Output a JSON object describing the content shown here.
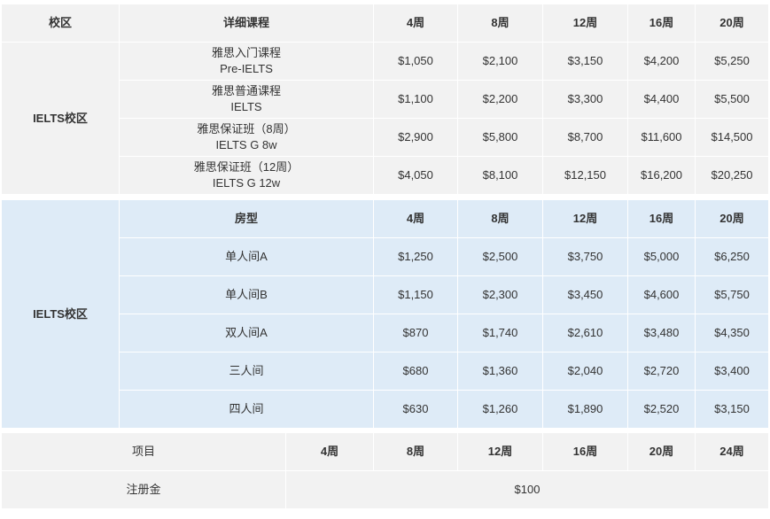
{
  "tuition": {
    "headers": [
      "校区",
      "详细课程",
      "4周",
      "8周",
      "12周",
      "16周",
      "20周"
    ],
    "campus": "IELTS校区",
    "rows": [
      {
        "course_cn": "雅思入门课程",
        "course_en": "Pre-IELTS",
        "prices": [
          "$1,050",
          "$2,100",
          "$3,150",
          "$4,200",
          "$5,250"
        ]
      },
      {
        "course_cn": "雅思普通课程",
        "course_en": "IELTS",
        "prices": [
          "$1,100",
          "$2,200",
          "$3,300",
          "$4,400",
          "$5,500"
        ]
      },
      {
        "course_cn": "雅思保证班（8周）",
        "course_en": "IELTS G 8w",
        "prices": [
          "$2,900",
          "$5,800",
          "$8,700",
          "$11,600",
          "$14,500"
        ]
      },
      {
        "course_cn": "雅思保证班（12周）",
        "course_en": "IELTS G 12w",
        "prices": [
          "$4,050",
          "$8,100",
          "$12,150",
          "$16,200",
          "$20,250"
        ]
      }
    ]
  },
  "dorm": {
    "campus": "IELTS校区",
    "headers": [
      "房型",
      "4周",
      "8周",
      "12周",
      "16周",
      "20周"
    ],
    "rows": [
      {
        "room": "单人间A",
        "prices": [
          "$1,250",
          "$2,500",
          "$3,750",
          "$5,000",
          "$6,250"
        ]
      },
      {
        "room": "单人间B",
        "prices": [
          "$1,150",
          "$2,300",
          "$3,450",
          "$4,600",
          "$5,750"
        ]
      },
      {
        "room": "双人间A",
        "prices": [
          "$870",
          "$1,740",
          "$2,610",
          "$3,480",
          "$4,350"
        ]
      },
      {
        "room": "三人间",
        "prices": [
          "$680",
          "$1,360",
          "$2,040",
          "$2,720",
          "$3,400"
        ]
      },
      {
        "room": "四人间",
        "prices": [
          "$630",
          "$1,260",
          "$1,890",
          "$2,520",
          "$3,150"
        ]
      }
    ]
  },
  "fees": {
    "headers": [
      "项目",
      "4周",
      "8周",
      "12周",
      "16周",
      "20周",
      "24周"
    ],
    "rows": [
      {
        "item": "注册金",
        "value": "$100"
      }
    ]
  }
}
